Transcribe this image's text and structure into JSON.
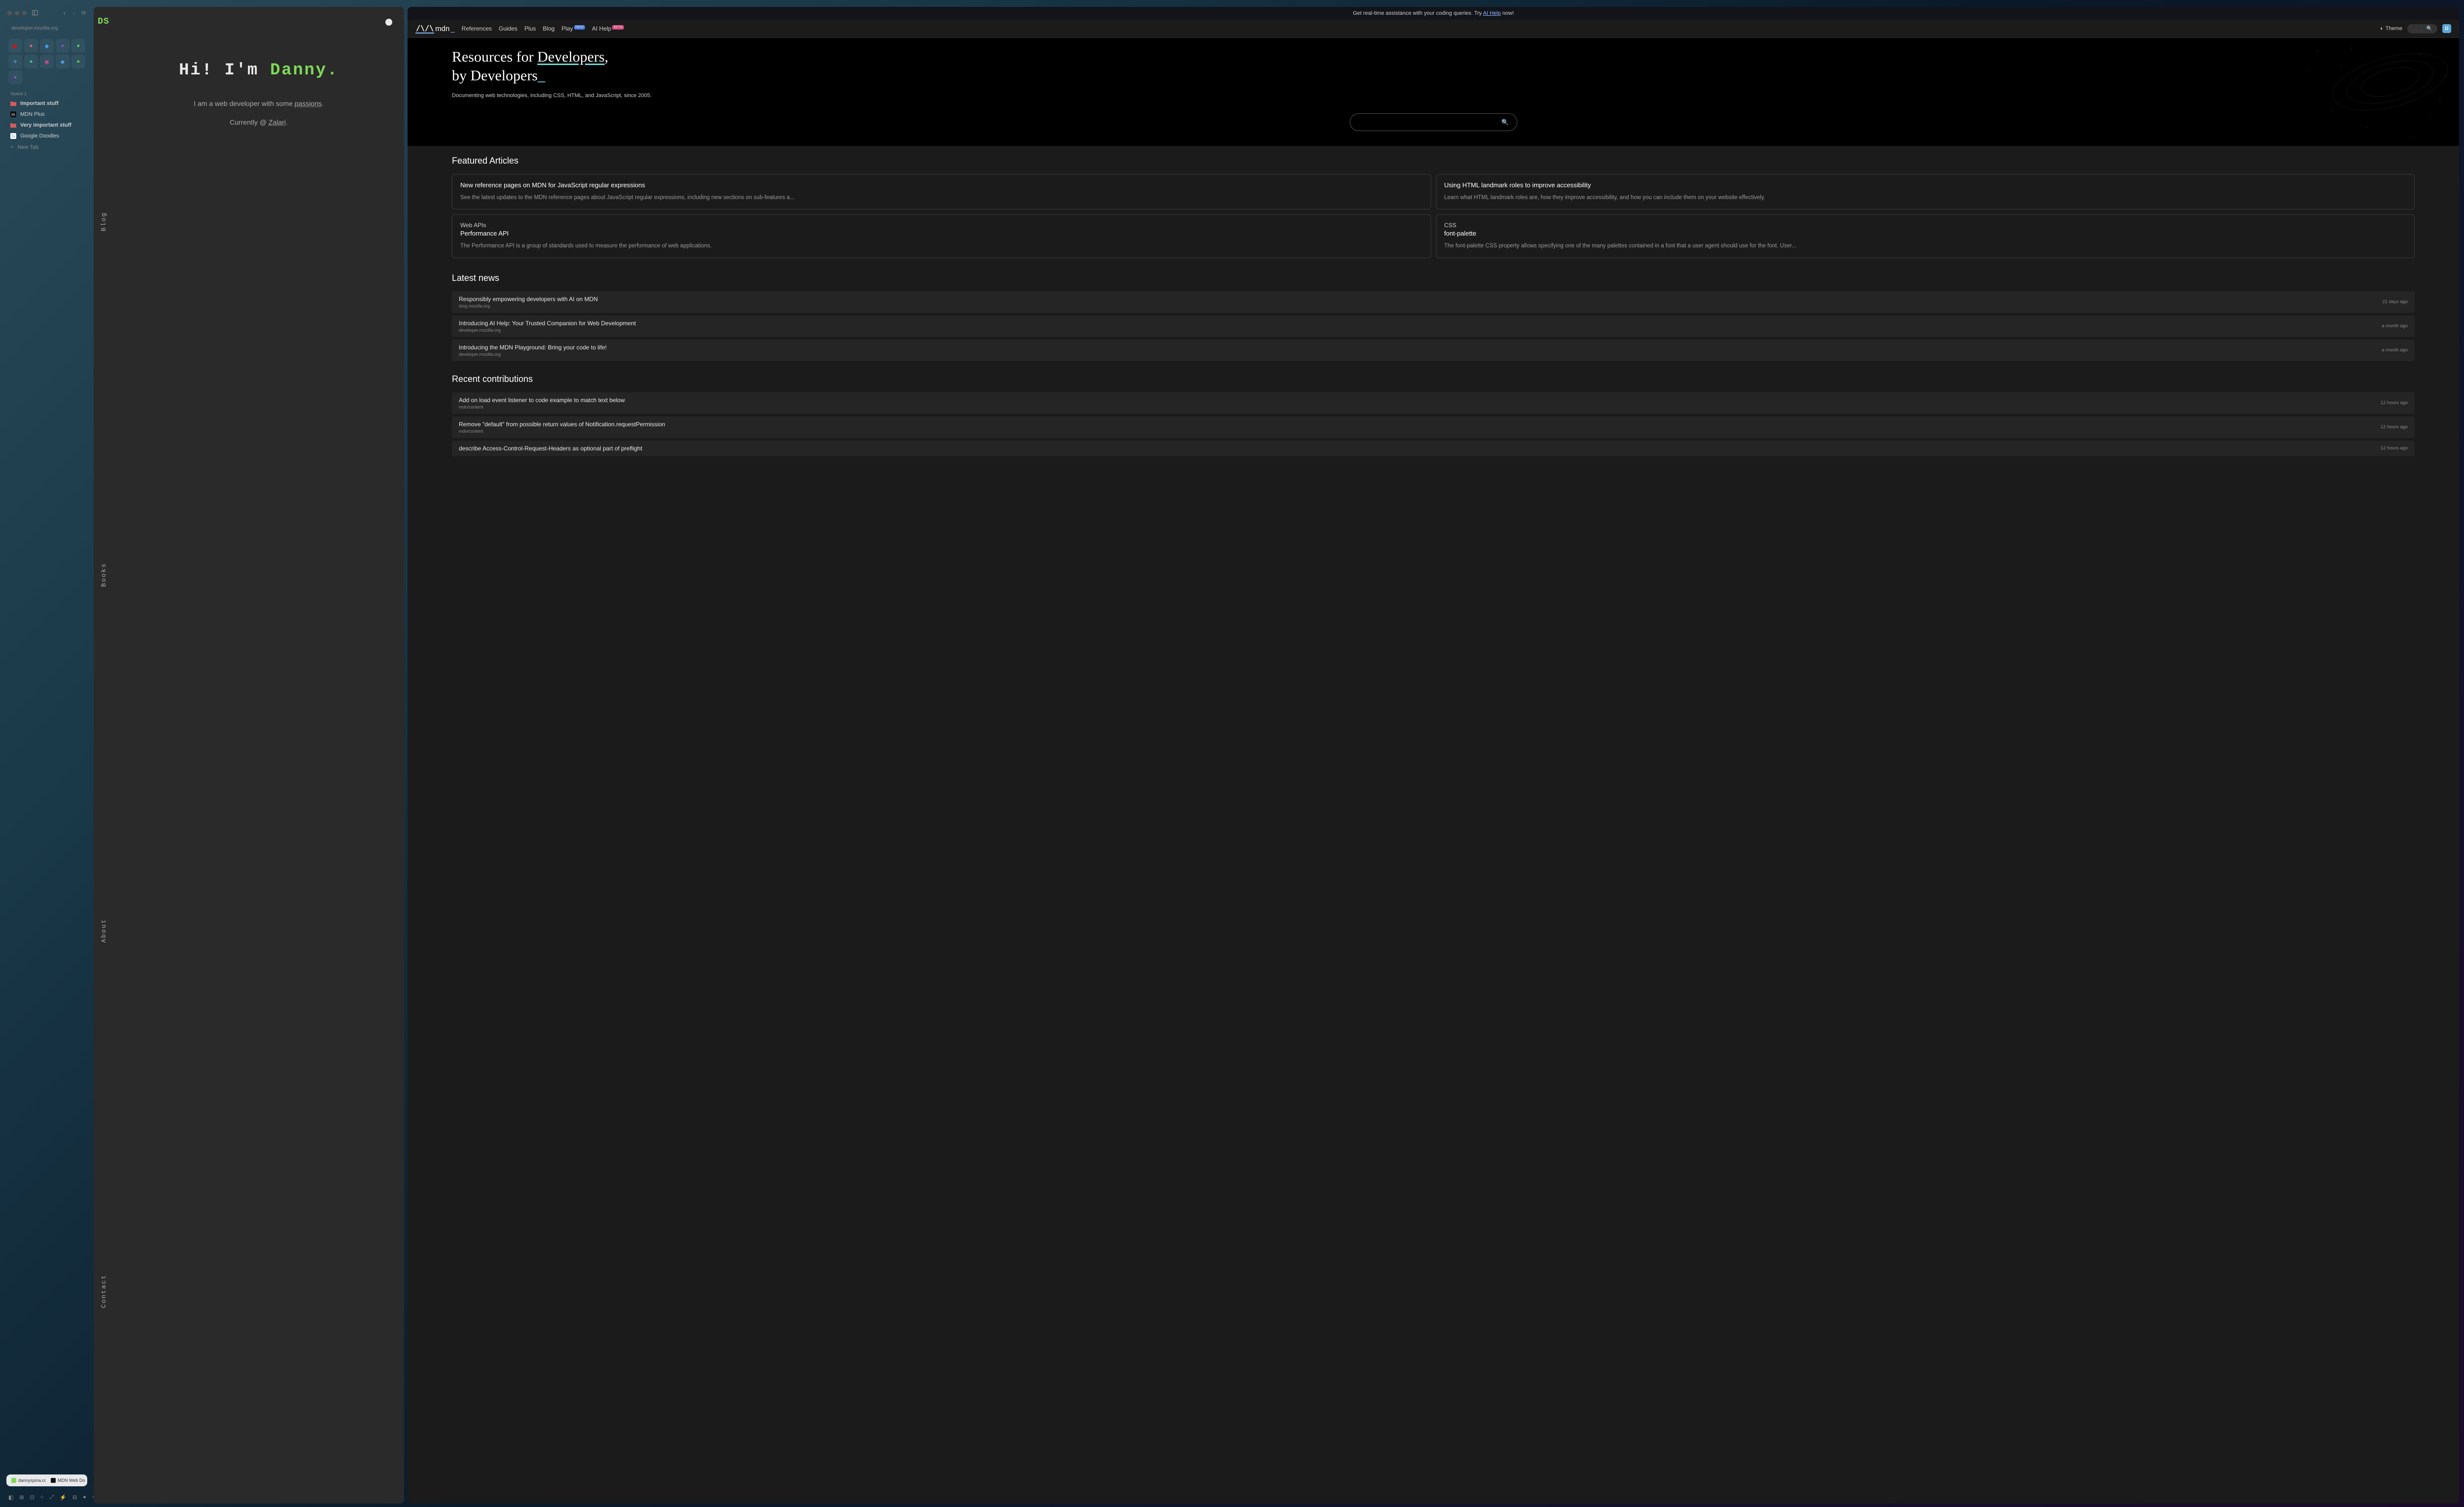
{
  "sidebar": {
    "url": "developer.mozilla.org",
    "space_label": "Space 1",
    "items": [
      {
        "icon": "folder-red",
        "label": "Important stuff",
        "bold": true
      },
      {
        "icon": "mdn",
        "label": "MDN Plus",
        "bold": false
      },
      {
        "icon": "folder-red",
        "label": "Very important stuff",
        "bold": true
      },
      {
        "icon": "google",
        "label": "Google Doodles",
        "bold": false
      }
    ],
    "new_tab": "New Tab",
    "tabs": [
      {
        "label": "dannyspina.com",
        "favicon_color": "#7fd858"
      },
      {
        "label": "MDN Web Docs",
        "favicon_color": "#111"
      }
    ],
    "app_tiles": [
      {
        "glyph": "▶",
        "color": "#ff0000"
      },
      {
        "glyph": "✦",
        "color": "#ff6b9d"
      },
      {
        "glyph": "◆",
        "color": "#4a9de8"
      },
      {
        "glyph": "✶",
        "color": "#a84ae8"
      },
      {
        "glyph": "●",
        "color": "#4ad858"
      },
      {
        "glyph": "✈",
        "color": "#4a9de8"
      },
      {
        "glyph": "✦",
        "color": "#4ad8a8"
      },
      {
        "glyph": "◉",
        "color": "#d84a9d"
      },
      {
        "glyph": "◆",
        "color": "#4a9de8"
      },
      {
        "glyph": "●",
        "color": "#4ad858"
      },
      {
        "glyph": "✦",
        "color": "#a84ae8"
      }
    ]
  },
  "ds": {
    "logo": "DS",
    "nav": [
      "Blog",
      "Books",
      "About",
      "Contact"
    ],
    "heading_prefix": "Hi! I'm ",
    "heading_name": "Danny.",
    "sub_prefix": "I am a web developer with some ",
    "sub_link": "passions",
    "sub_suffix": ".",
    "sub2_prefix": "Currently @ ",
    "sub2_link": "Zalari",
    "sub2_suffix": "."
  },
  "mdn": {
    "banner_prefix": "Get real-time assistance with your coding queries. Try ",
    "banner_link": "AI Help",
    "banner_suffix": " now!",
    "logo_text": "mdn",
    "nav": [
      {
        "label": "References",
        "badge": null
      },
      {
        "label": "Guides",
        "badge": null
      },
      {
        "label": "Plus",
        "badge": null
      },
      {
        "label": "Blog",
        "badge": null
      },
      {
        "label": "Play",
        "badge": "NEW"
      },
      {
        "label": "AI Help",
        "badge": "BETA"
      }
    ],
    "theme_label": "Theme",
    "search_hint": "___",
    "avatar_letter": "D",
    "hero_line1_a": "Resources for ",
    "hero_line1_b": "Developers",
    "hero_line1_c": ",",
    "hero_line2": "by Developers",
    "hero_cursor": "_",
    "hero_sub": "Documenting web technologies, including CSS, HTML, and JavaScript, since 2005.",
    "featured_title": "Featured Articles",
    "featured": [
      {
        "cat": "",
        "title": "New reference pages on MDN for JavaScript regular expressions",
        "desc": "See the latest updates to the MDN reference pages about JavaScript regular expressions, including new sections on sub-features a..."
      },
      {
        "cat": "",
        "title": "Using HTML landmark roles to improve accessibility",
        "desc": "Learn what HTML landmark roles are, how they improve accessibility, and how you can include them on your website effectively."
      },
      {
        "cat": "Web APIs",
        "title": "Performance API",
        "desc": "The Performance API is a group of standards used to measure the performance of web applications."
      },
      {
        "cat": "CSS",
        "title": "font-palette",
        "desc": "The font-palette CSS property allows specifying one of the many palettes contained in a font that a user agent should use for the font. User..."
      }
    ],
    "news_title": "Latest news",
    "news": [
      {
        "title": "Responsibly empowering developers with AI on MDN",
        "source": "blog.mozilla.org",
        "time": "21 days ago"
      },
      {
        "title": "Introducing AI Help: Your Trusted Companion for Web Development",
        "source": "developer.mozilla.org",
        "time": "a month ago"
      },
      {
        "title": "Introducing the MDN Playground: Bring your code to life!",
        "source": "developer.mozilla.org",
        "time": "a month ago"
      }
    ],
    "contrib_title": "Recent contributions",
    "contrib": [
      {
        "title": "Add on load event listener to code example to match text below",
        "source": "mdn/content",
        "time": "12 hours ago"
      },
      {
        "title": "Remove \"default\" from possible return values of Notification.requestPermission",
        "source": "mdn/content",
        "time": "12 hours ago"
      },
      {
        "title": "describe Access-Control-Request-Headers as optional part of preflight",
        "source": "",
        "time": "12 hours ago"
      }
    ]
  }
}
